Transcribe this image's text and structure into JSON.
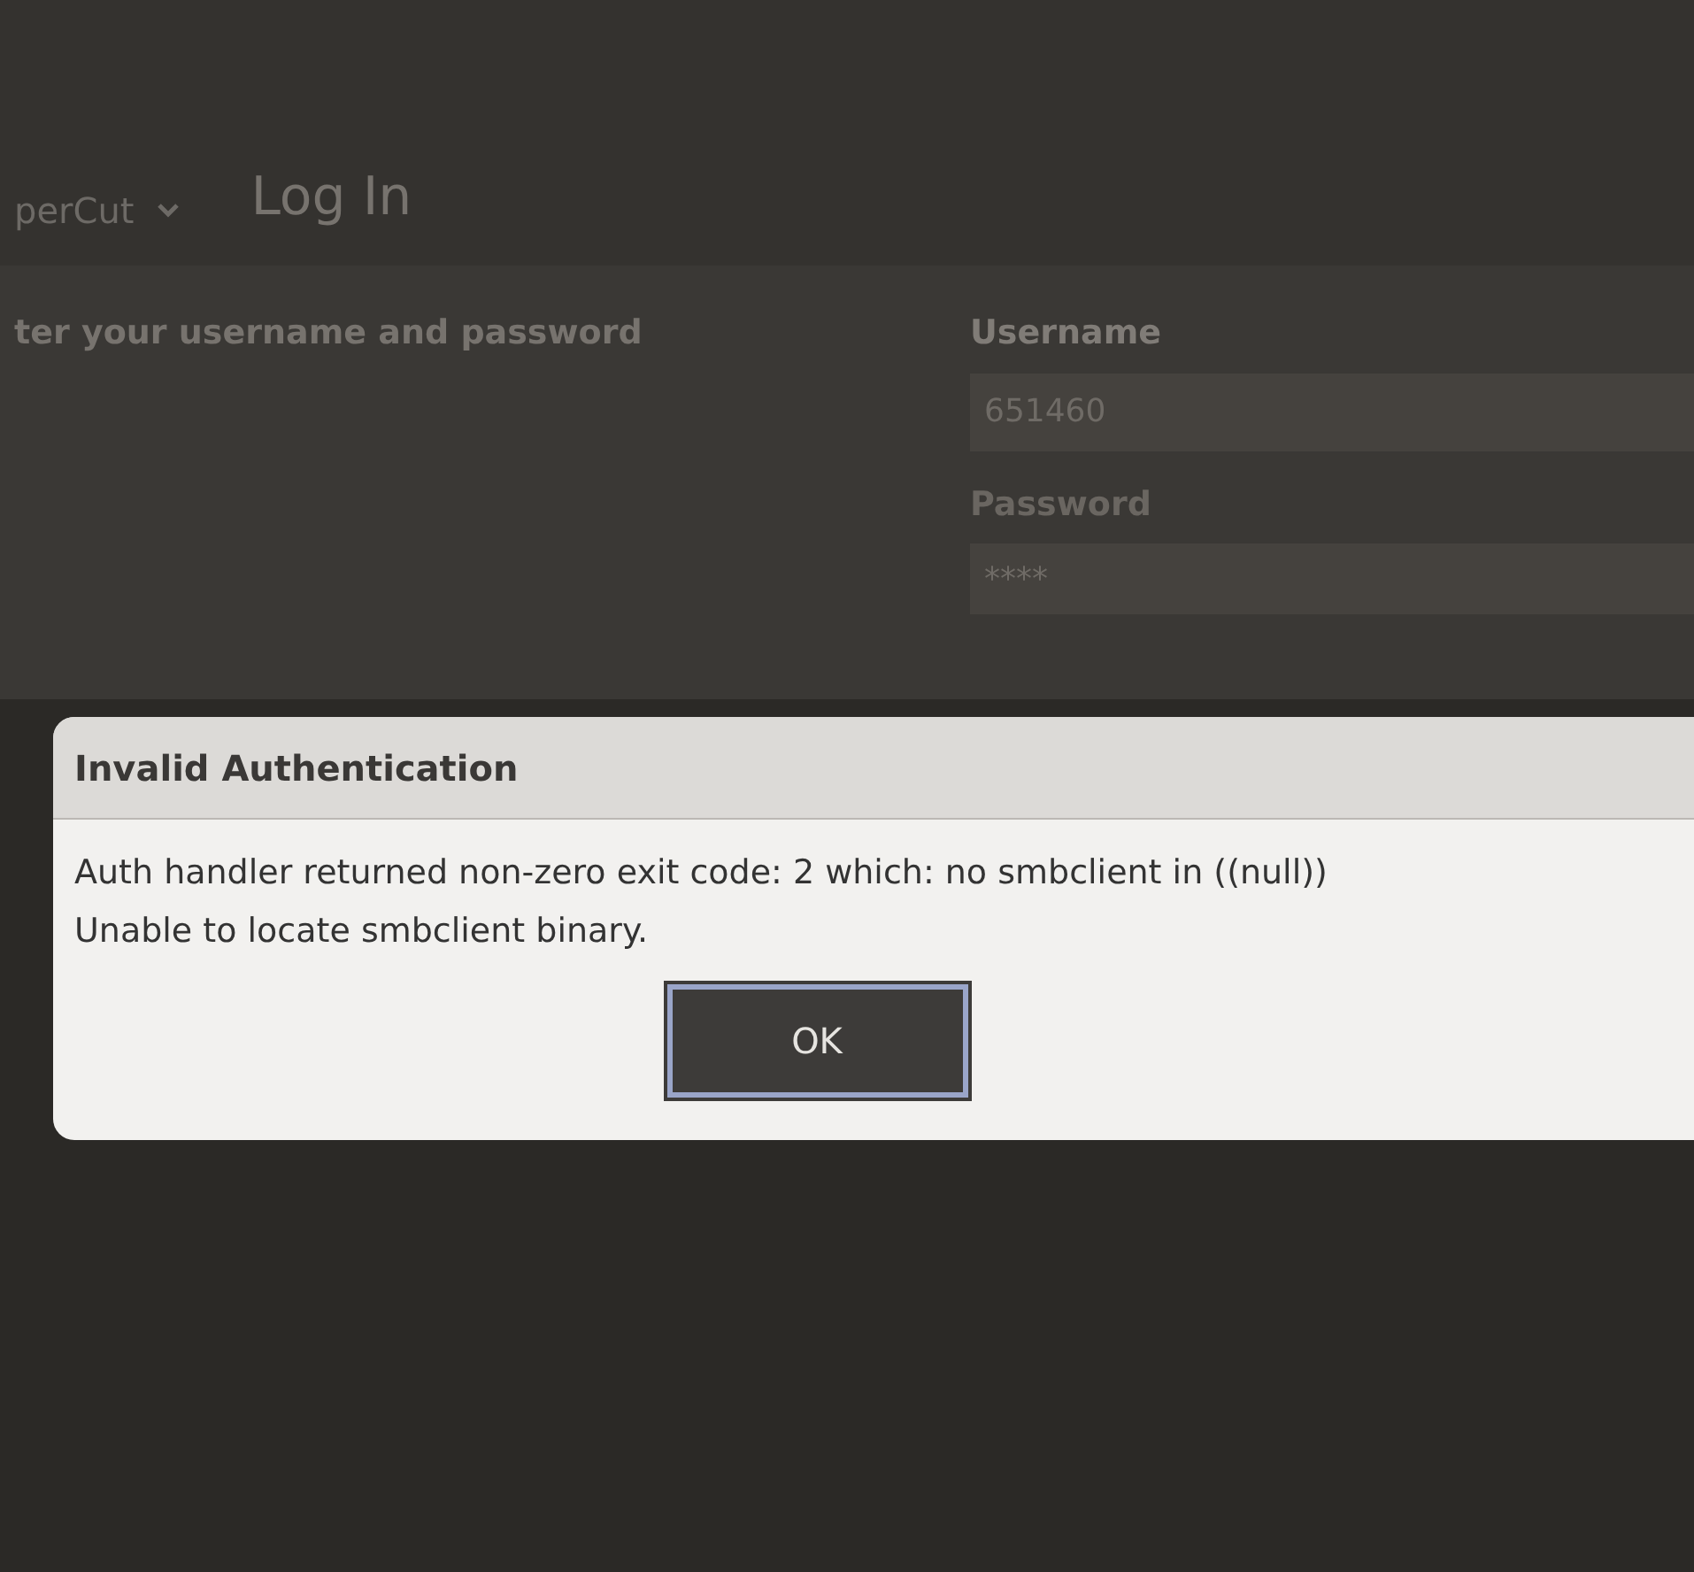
{
  "header": {
    "app_name": "perCut",
    "title": "Log In"
  },
  "login": {
    "instruction": "ter your username and password",
    "username_label": "Username",
    "username_value": "651460",
    "password_label": "Password",
    "password_value": "****"
  },
  "dialog": {
    "title": "Invalid Authentication",
    "message": [
      "Auth handler returned non-zero exit code: 2 which: no smbclient in ((null))",
      "Unable to locate smbclient binary."
    ],
    "buttons": [
      "OK"
    ]
  }
}
